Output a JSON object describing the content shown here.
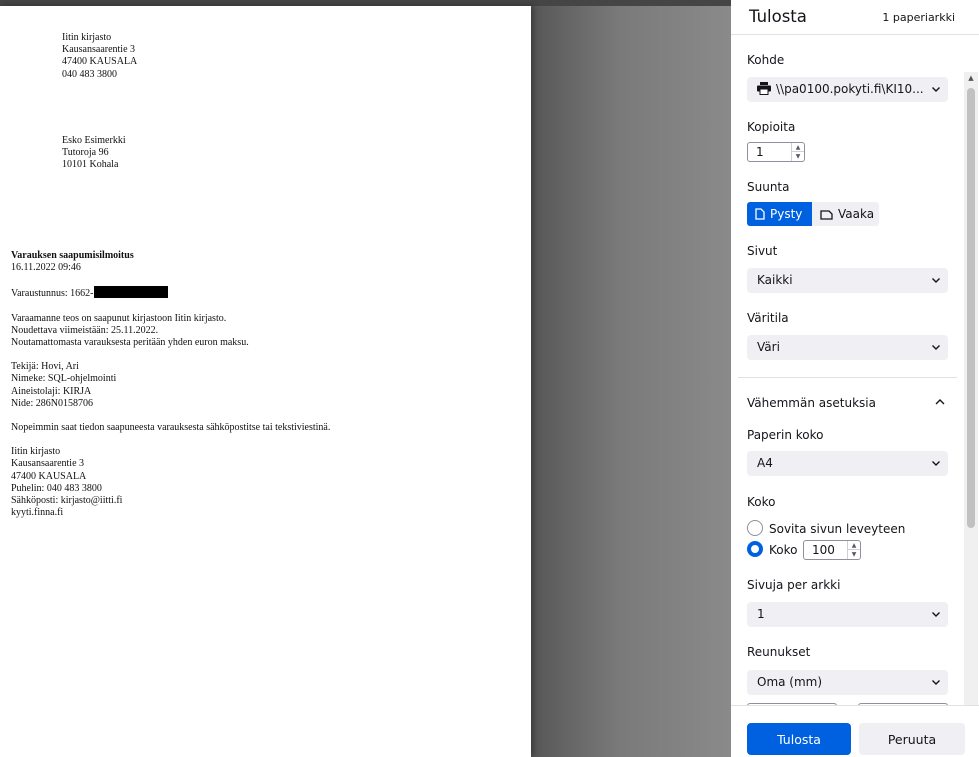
{
  "document": {
    "sender": [
      "Iitin kirjasto",
      "Kausansaarentie 3",
      "47400 KAUSALA",
      "040 483 3800"
    ],
    "recipient": [
      "Esko Esimerkki",
      "Tutoroja 96",
      "10101 Kohala"
    ],
    "notice_title": "Varauksen saapumisilmoitus",
    "notice_datetime": "16.11.2022 09:46",
    "reservation_code_label": "Varaustunnus: 1662-",
    "message_lines": [
      "Varaamanne teos on saapunut kirjastoon Iitin kirjasto.",
      "Noudettava viimeistään: 25.11.2022.",
      "Noutamattomasta varauksesta peritään yhden euron maksu."
    ],
    "item_lines": [
      "Tekijä: Hovi, Ari",
      "Nimeke: SQL-ohjelmointi",
      "Aineistolaji: KIRJA",
      "Nide: 286N0158706"
    ],
    "tip": "Nopeimmin saat tiedon saapuneesta varauksesta sähköpostitse tai tekstiviestinä.",
    "footer_lines": [
      "Iitin kirjasto",
      "Kausansaarentie 3",
      "47400 KAUSALA",
      "Puhelin: 040 483 3800",
      "Sähköposti: kirjasto@iitti.fi",
      "kyyti.finna.fi"
    ]
  },
  "sidebar": {
    "title": "Tulosta",
    "sheet_count": "1 paperiarkki",
    "destination": {
      "label": "Kohde",
      "value": "\\\\pa0100.pokyti.fi\\KI10..."
    },
    "copies": {
      "label": "Kopioita",
      "value": "1"
    },
    "orientation": {
      "label": "Suunta",
      "portrait": "Pysty",
      "landscape": "Vaaka",
      "selected": "portrait"
    },
    "pages": {
      "label": "Sivut",
      "value": "Kaikki"
    },
    "color": {
      "label": "Väritila",
      "value": "Väri"
    },
    "less_settings": "Vähemmän asetuksia",
    "paper_size": {
      "label": "Paperin koko",
      "value": "A4"
    },
    "scale": {
      "label": "Koko",
      "fit_option": "Sovita sivun leveyteen",
      "custom_option": "Koko",
      "custom_value": "100",
      "selected": "custom"
    },
    "pages_per_sheet": {
      "label": "Sivuja per arkki",
      "value": "1"
    },
    "margins": {
      "label": "Reunukset",
      "value": "Oma (mm)"
    },
    "print_label": "Tulosta",
    "cancel_label": "Peruuta"
  },
  "colors": {
    "accent": "#0061e0",
    "select_bg": "#f0f0f4",
    "text": "#15141a"
  },
  "icons": [
    "printer-icon",
    "portrait-page-icon",
    "landscape-page-icon",
    "chevron-down-icon",
    "chevron-up-icon"
  ]
}
